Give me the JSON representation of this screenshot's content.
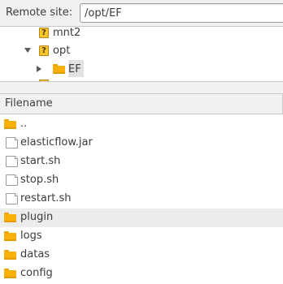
{
  "remote_site": {
    "label": "Remote site:",
    "path": "/opt/EF"
  },
  "tree": {
    "items": [
      {
        "label": "mnt2",
        "icon": "unknown-folder-icon",
        "expander": "none"
      },
      {
        "label": "opt",
        "icon": "unknown-folder-icon",
        "expander": "expanded"
      },
      {
        "label": "EF",
        "icon": "folder-icon",
        "expander": "collapsed",
        "selected": true
      }
    ]
  },
  "file_list": {
    "column_header": "Filename",
    "files": [
      {
        "name": "..",
        "type": "folder"
      },
      {
        "name": "elasticflow.jar",
        "type": "file"
      },
      {
        "name": "start.sh",
        "type": "file"
      },
      {
        "name": "stop.sh",
        "type": "file"
      },
      {
        "name": "restart.sh",
        "type": "file"
      },
      {
        "name": "plugin",
        "type": "folder",
        "selected": true
      },
      {
        "name": "logs",
        "type": "folder"
      },
      {
        "name": "datas",
        "type": "folder"
      },
      {
        "name": "config",
        "type": "folder"
      }
    ]
  },
  "colors": {
    "window_bg": "#f2f1f0",
    "list_bg": "#ffffff",
    "folder": "#f9b10a",
    "unknown_icon": "#f7c42b",
    "selected_row": "#ececec"
  }
}
